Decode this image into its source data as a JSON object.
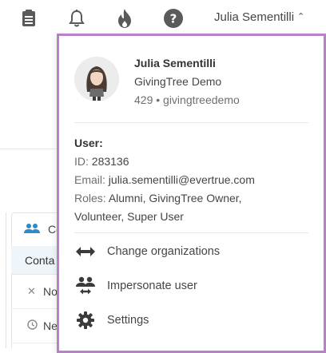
{
  "topbar": {
    "icons": [
      "clipboard-icon",
      "bell-icon",
      "flame-icon",
      "help-icon"
    ],
    "user_name": "Julia Sementilli",
    "chevron": "⌃"
  },
  "background": {
    "section_label": "Co",
    "subheader": "Conta",
    "rows": [
      {
        "icon": "close-icon",
        "label": "No"
      },
      {
        "icon": "clock-icon",
        "label": "Ne"
      }
    ]
  },
  "dropdown": {
    "profile": {
      "name": "Julia Sementilli",
      "org": "GivingTree Demo",
      "meta": "429 • givingtreedemo"
    },
    "user_info": {
      "heading": "User:",
      "id_label": "ID:",
      "id_value": "283136",
      "email_label": "Email:",
      "email_value": "julia.sementilli@evertrue.com",
      "roles_label": "Roles:",
      "roles_line1": "Alumni, GivingTree Owner,",
      "roles_line2": "Volunteer, Super User"
    },
    "menu": [
      {
        "icon": "swap-horizontal-icon",
        "label": "Change organizations"
      },
      {
        "icon": "impersonate-user-icon",
        "label": "Impersonate user"
      },
      {
        "icon": "gear-icon",
        "label": "Settings"
      }
    ]
  },
  "colors": {
    "dropdown_border": "#b97fc9",
    "accent_blue": "#2e8bc9",
    "text": "#454545"
  }
}
